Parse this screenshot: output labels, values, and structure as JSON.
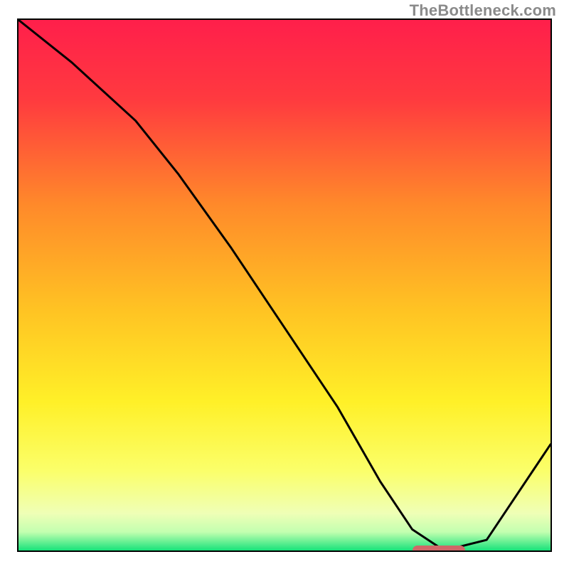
{
  "attribution": "TheBottleneck.com",
  "colors": {
    "gradient_stops": [
      {
        "offset": 0.0,
        "color": "#ff1f4b"
      },
      {
        "offset": 0.15,
        "color": "#ff3a3f"
      },
      {
        "offset": 0.35,
        "color": "#ff8a2a"
      },
      {
        "offset": 0.55,
        "color": "#ffc423"
      },
      {
        "offset": 0.72,
        "color": "#fff028"
      },
      {
        "offset": 0.85,
        "color": "#fbff6a"
      },
      {
        "offset": 0.93,
        "color": "#efffb6"
      },
      {
        "offset": 0.965,
        "color": "#c3ffb0"
      },
      {
        "offset": 1.0,
        "color": "#17e27a"
      }
    ],
    "curve": "#000000",
    "indicator": "#d06868",
    "border": "#000000"
  },
  "chart_data": {
    "type": "line",
    "title": "",
    "xlabel": "",
    "ylabel": "",
    "xlim": [
      0,
      100
    ],
    "ylim": [
      0,
      100
    ],
    "grid": false,
    "series": [
      {
        "name": "bottleneck-curve",
        "x": [
          0,
          10,
          22,
          30,
          40,
          50,
          60,
          68,
          74,
          80,
          88,
          100
        ],
        "values": [
          100,
          92,
          81,
          71,
          57,
          42,
          27,
          13,
          4,
          0,
          2,
          20
        ]
      }
    ],
    "annotations": [
      {
        "name": "optimal-zone",
        "x_start": 74,
        "x_end": 84,
        "y": 0
      }
    ]
  }
}
